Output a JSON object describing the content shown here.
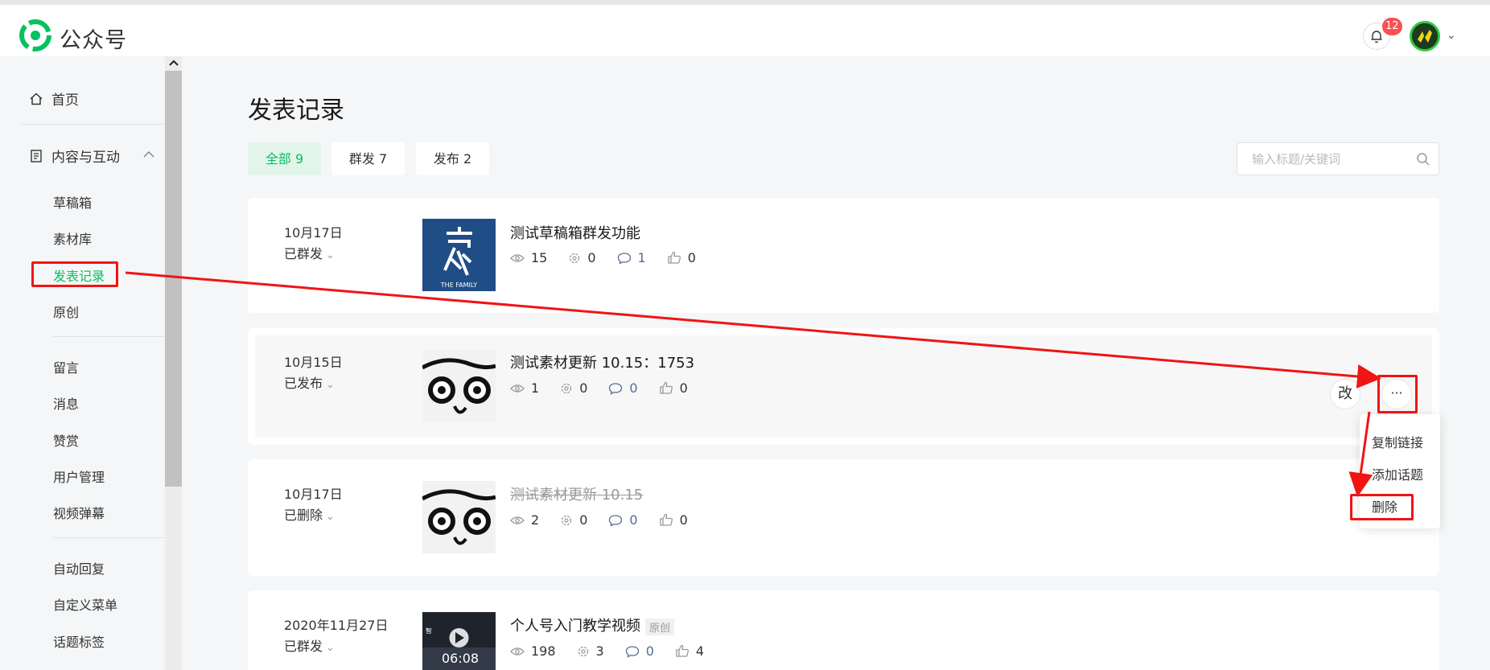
{
  "app": {
    "brand": "公众号",
    "notif_count": "12"
  },
  "sidebar": {
    "home": "首页",
    "content_group": "内容与互动",
    "items": [
      "草稿箱",
      "素材库",
      "发表记录",
      "原创",
      "留言",
      "消息",
      "赞赏",
      "用户管理",
      "视频弹幕",
      "自动回复",
      "自定义菜单",
      "话题标签"
    ]
  },
  "main": {
    "title": "发表记录",
    "tabs": [
      "全部 9",
      "群发 7",
      "发布 2"
    ],
    "search_placeholder": "输入标题/关键词"
  },
  "records": [
    {
      "date": "10月17日",
      "status": "已群发",
      "title": "测试草稿箱群发功能",
      "reads": "15",
      "shares": "0",
      "comments": "1",
      "likes": "0",
      "thumb_text": "THE FAMILY"
    },
    {
      "date": "10月15日",
      "status": "已发布",
      "title": "测试素材更新 10.15：1753",
      "reads": "1",
      "shares": "0",
      "comments": "0",
      "likes": "0"
    },
    {
      "date": "10月17日",
      "status": "已删除",
      "title": "测试素材更新 10.15",
      "reads": "2",
      "shares": "0",
      "comments": "0",
      "likes": "0"
    },
    {
      "date": "2020年11月27日",
      "status": "已群发",
      "title": "个人号入门教学视频",
      "badge": "原创",
      "reads": "198",
      "shares": "3",
      "comments": "0",
      "likes": "4",
      "duration": "06:08",
      "thumb_caption": "智"
    }
  ],
  "actions": {
    "edit": "改",
    "more": "···"
  },
  "menu": [
    "复制链接",
    "添加话题",
    "删除"
  ],
  "colors": {
    "accent": "#07c160",
    "annotation": "#f01414",
    "link": "#576b95"
  }
}
